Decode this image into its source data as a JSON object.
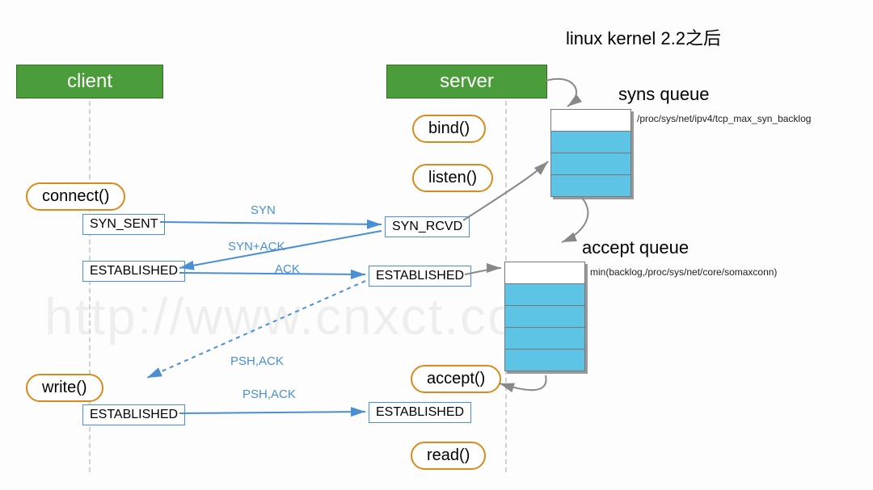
{
  "title": "linux  kernel 2.2之后",
  "client": {
    "header": "client",
    "connect": "connect()",
    "write": "write()",
    "syn_sent": "SYN_SENT",
    "established1": "ESTABLISHED",
    "established2": "ESTABLISHED"
  },
  "server": {
    "header": "server",
    "bind": "bind()",
    "listen": "listen()",
    "accept": "accept()",
    "read": "read()",
    "syn_rcvd": "SYN_RCVD",
    "established1": "ESTABLISHED",
    "established2": "ESTABLISHED"
  },
  "packets": {
    "syn": "SYN",
    "synack": "SYN+ACK",
    "ack": "ACK",
    "pshack1": "PSH,ACK",
    "pshack2": "PSH,ACK"
  },
  "queues": {
    "syns": {
      "title": "syns queue",
      "path": "/proc/sys/net/ipv4/tcp_max_syn_backlog"
    },
    "accept": {
      "title": "accept queue",
      "path": "min(backlog,/proc/sys/net/core/somaxconn)"
    }
  },
  "watermark": "http://www.cnxct.com"
}
